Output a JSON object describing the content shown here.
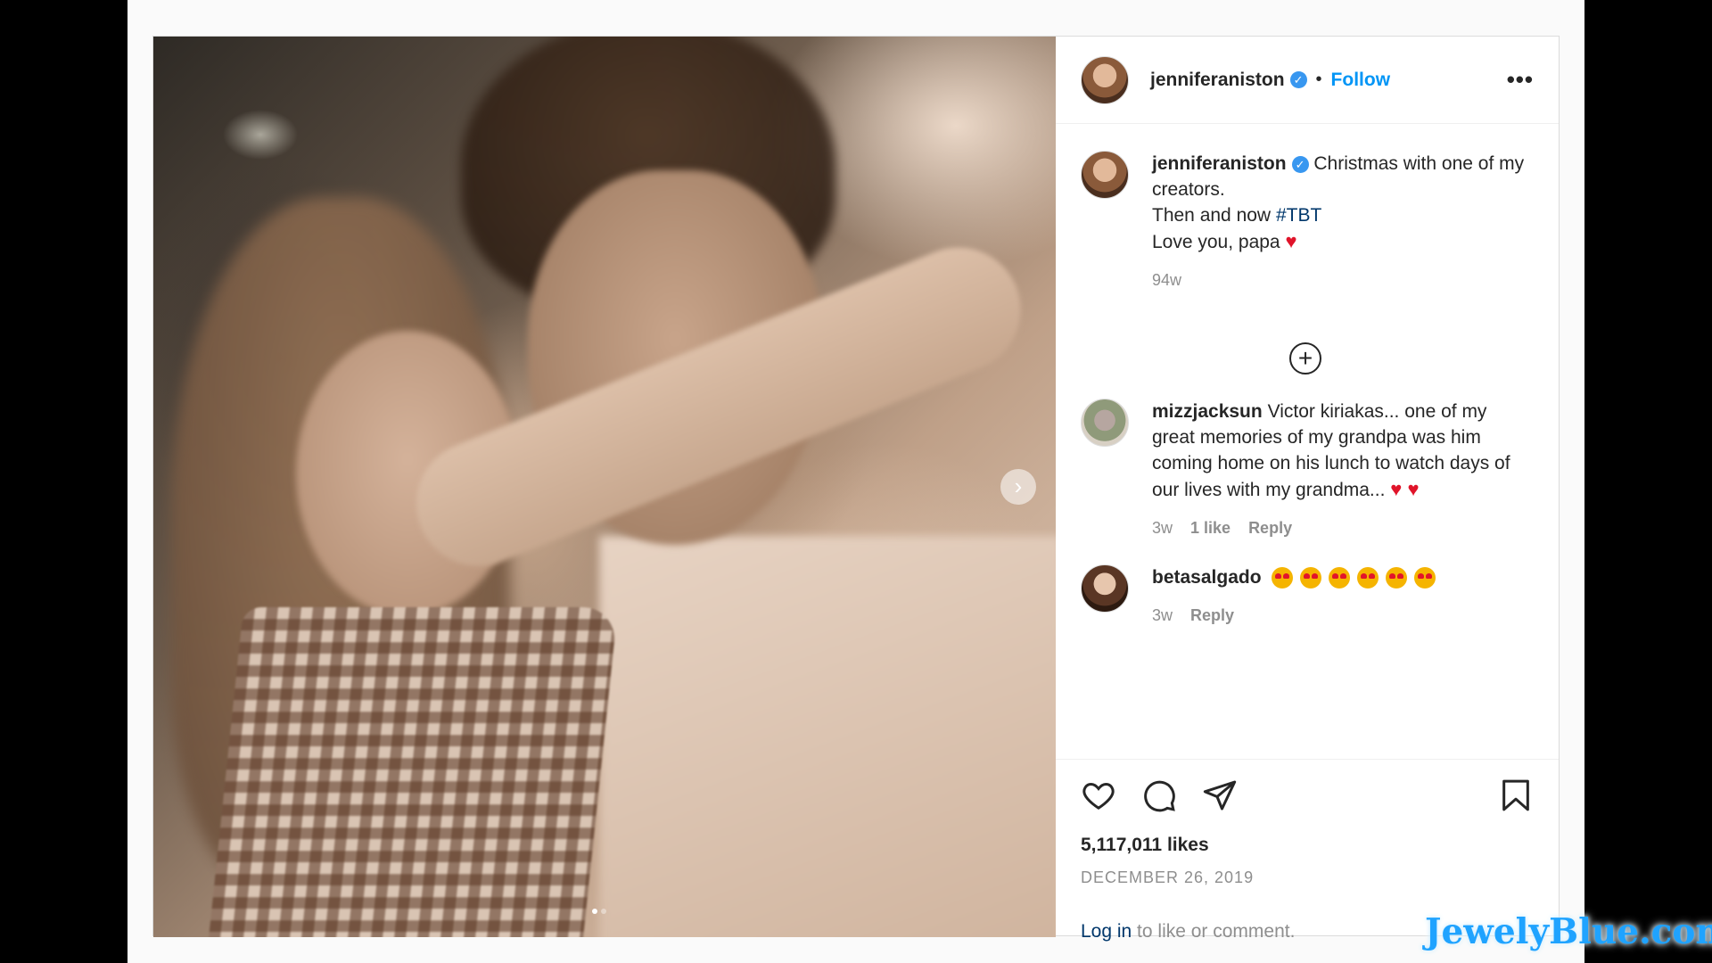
{
  "post": {
    "author": "jenniferaniston",
    "follow_label": "Follow",
    "separator": "•",
    "more_label": "•••",
    "next_arrow": "›",
    "caption": {
      "line1": "Christmas with one of my creators.",
      "line2_prefix": "Then and now ",
      "hashtag": "#TBT",
      "line3": "Love you, papa",
      "heart": "♥",
      "age": "94w"
    },
    "load_more_icon": "+",
    "comments": [
      {
        "user": "mizzjacksun",
        "text": "Victor kiriakas... one of my great memories of my grandpa was him coming home on his lunch to watch days of our lives with my grandma...",
        "hearts": "♥ ♥",
        "age": "3w",
        "likes": "1 like",
        "reply": "Reply"
      },
      {
        "user": "betasalgado",
        "emoji": "star-struck-emoji",
        "emoji_count": 6,
        "age": "3w",
        "reply": "Reply"
      }
    ],
    "likes": "5,117,011 likes",
    "date": "DECEMBER 26, 2019",
    "login_link": "Log in",
    "login_rest": " to like or comment."
  },
  "watermark": "JewelyBlue.com",
  "icons": [
    "heart-icon",
    "comment-icon",
    "share-icon",
    "bookmark-icon",
    "verified-icon",
    "plus-circle-icon",
    "chevron-right-icon"
  ],
  "colors": {
    "link": "#0095f6",
    "verified": "#3897f0",
    "hashtag": "#00376b",
    "muted": "#8e8e8e"
  }
}
